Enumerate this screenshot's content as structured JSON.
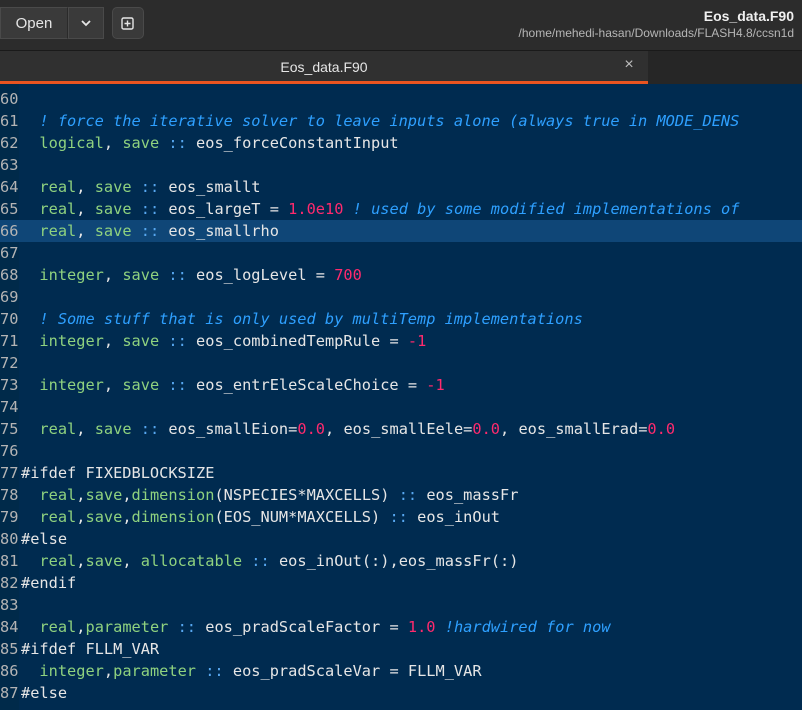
{
  "header": {
    "open_label": "Open",
    "file_name": "Eos_data.F90",
    "file_path": "/home/mehedi-hasan/Downloads/FLASH4.8/ccsn1d"
  },
  "tab": {
    "label": "Eos_data.F90",
    "close_glyph": "×"
  },
  "icons": {
    "menu": "chevron-down-icon",
    "new_tab": "new-tab-icon",
    "close": "close-icon"
  },
  "colors": {
    "accent": "#e95420",
    "keyword": "#8fd27f",
    "number": "#ff2a6d",
    "comment": "#2ea0ff",
    "editor_bg": "#002b50",
    "current_line": "#0f4677"
  },
  "editor": {
    "current_line": "66",
    "lines": [
      {
        "n": "60",
        "t": ""
      },
      {
        "n": "61",
        "t": "  ! force the iterative solver to leave inputs alone (always true in MODE_DENS"
      },
      {
        "n": "62",
        "t": "  logical, save :: eos_forceConstantInput"
      },
      {
        "n": "63",
        "t": ""
      },
      {
        "n": "64",
        "t": "  real, save :: eos_smallt"
      },
      {
        "n": "65",
        "t": "  real, save :: eos_largeT = 1.0e10 ! used by some modified implementations of"
      },
      {
        "n": "66",
        "t": "  real, save :: eos_smallrho"
      },
      {
        "n": "67",
        "t": ""
      },
      {
        "n": "68",
        "t": "  integer, save :: eos_logLevel = 700"
      },
      {
        "n": "69",
        "t": ""
      },
      {
        "n": "70",
        "t": "  ! Some stuff that is only used by multiTemp implementations"
      },
      {
        "n": "71",
        "t": "  integer, save :: eos_combinedTempRule = -1"
      },
      {
        "n": "72",
        "t": ""
      },
      {
        "n": "73",
        "t": "  integer, save :: eos_entrEleScaleChoice = -1"
      },
      {
        "n": "74",
        "t": ""
      },
      {
        "n": "75",
        "t": "  real, save :: eos_smallEion=0.0, eos_smallEele=0.0, eos_smallErad=0.0"
      },
      {
        "n": "76",
        "t": ""
      },
      {
        "n": "77",
        "t": "#ifdef FIXEDBLOCKSIZE"
      },
      {
        "n": "78",
        "t": "  real,save,dimension(NSPECIES*MAXCELLS) :: eos_massFr"
      },
      {
        "n": "79",
        "t": "  real,save,dimension(EOS_NUM*MAXCELLS) :: eos_inOut"
      },
      {
        "n": "80",
        "t": "#else"
      },
      {
        "n": "81",
        "t": "  real,save, allocatable :: eos_inOut(:),eos_massFr(:)"
      },
      {
        "n": "82",
        "t": "#endif"
      },
      {
        "n": "83",
        "t": ""
      },
      {
        "n": "84",
        "t": "  real,parameter :: eos_pradScaleFactor = 1.0 !hardwired for now"
      },
      {
        "n": "85",
        "t": "#ifdef FLLM_VAR"
      },
      {
        "n": "86",
        "t": "  integer,parameter :: eos_pradScaleVar = FLLM_VAR"
      },
      {
        "n": "87",
        "t": "#else"
      }
    ]
  }
}
